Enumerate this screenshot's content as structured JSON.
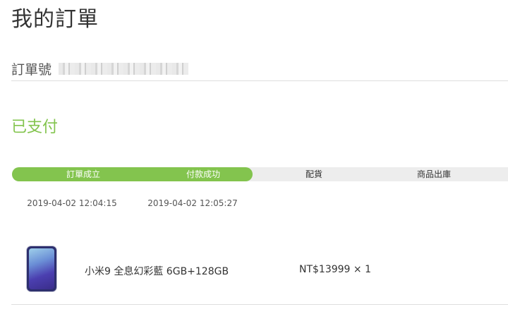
{
  "page": {
    "title": "我的訂單"
  },
  "order": {
    "number_label": "訂單號",
    "status": "已支付"
  },
  "progress": {
    "completed_fraction": 0.485,
    "steps": [
      {
        "label": "訂單成立",
        "time": "2019-04-02 12:04:15",
        "done": true
      },
      {
        "label": "付款成功",
        "time": "2019-04-02 12:05:27",
        "done": true
      },
      {
        "label": "配貨",
        "time": "",
        "done": false
      },
      {
        "label": "商品出庫",
        "time": "",
        "done": false
      }
    ]
  },
  "product": {
    "name": "小米9 全息幻彩藍 6GB+128GB",
    "price_qty": "NT$13999 × 1",
    "thumbnail_icon": "phone-icon"
  },
  "colors": {
    "accent": "#83c44e",
    "track": "#ededed"
  }
}
